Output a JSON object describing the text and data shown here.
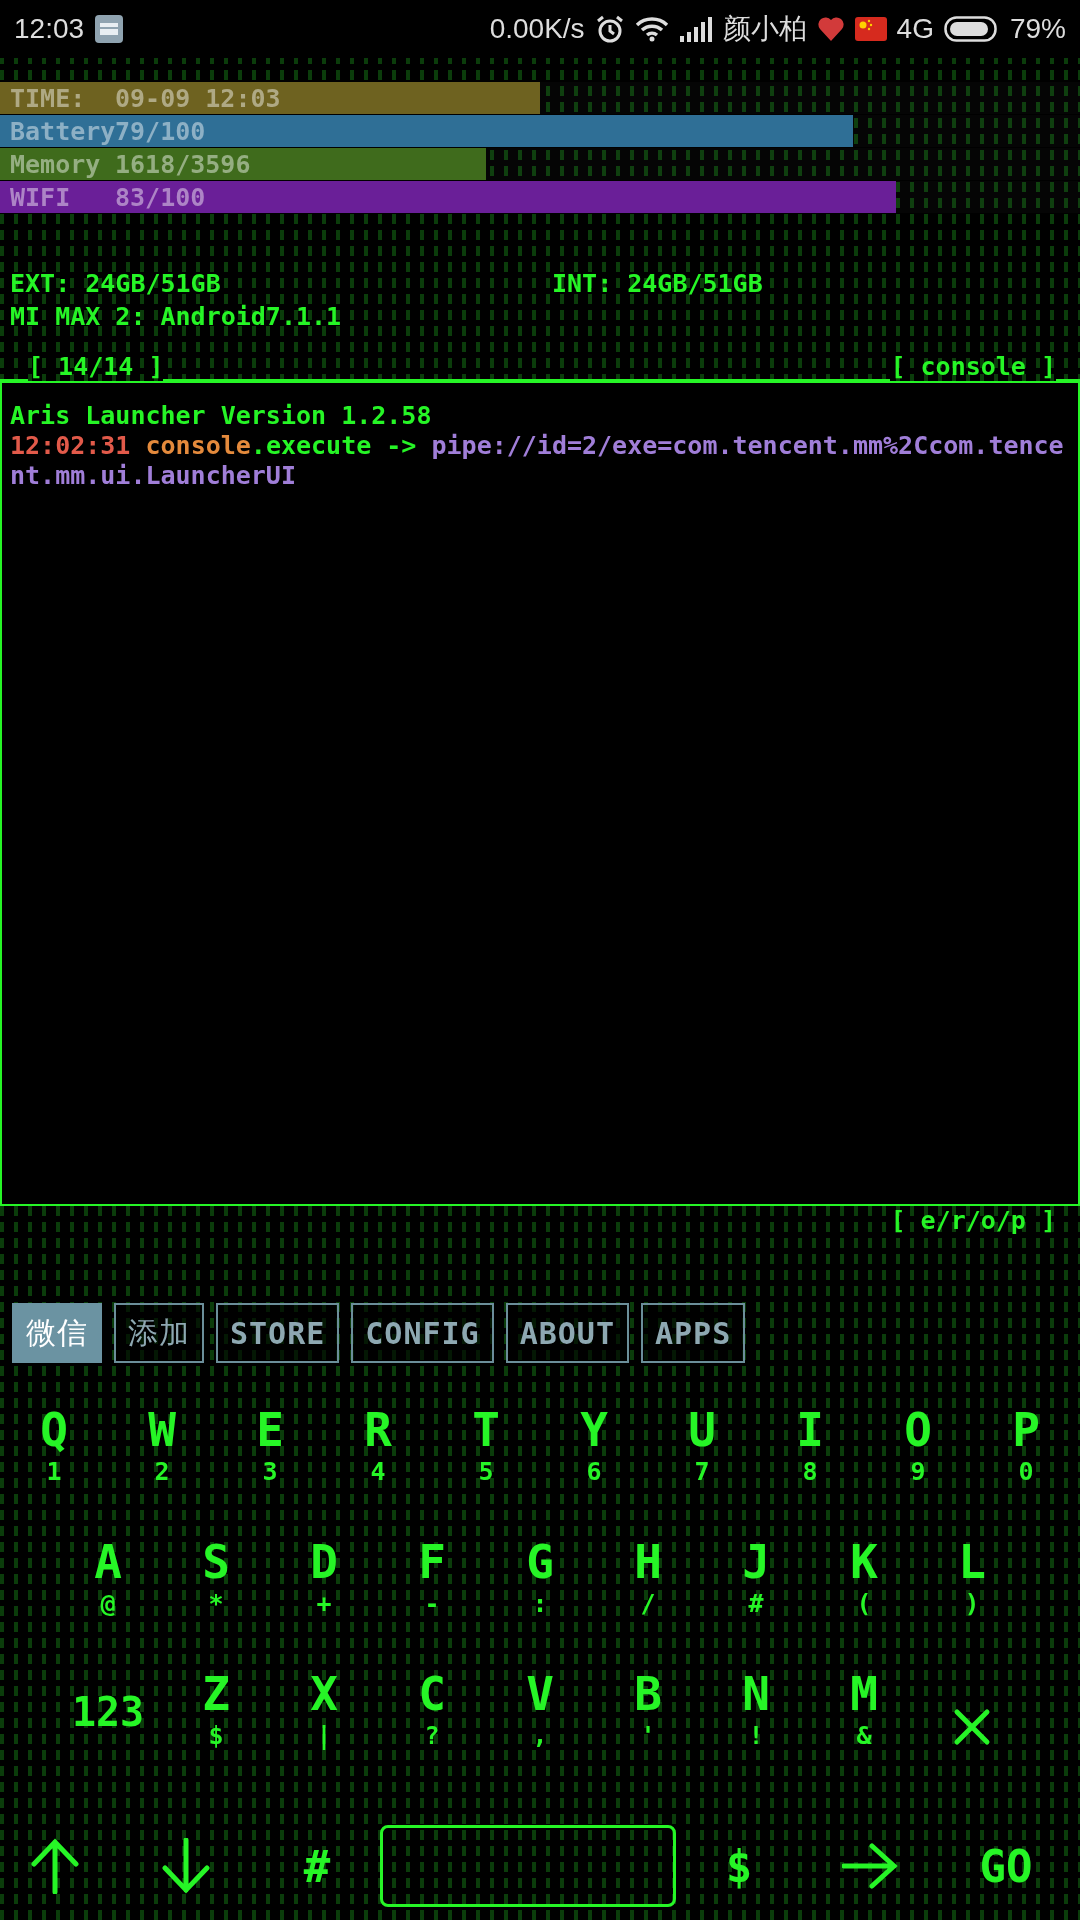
{
  "status_bar": {
    "time": "12:03",
    "net_speed": "0.00K/s",
    "carrier": "颜小柏",
    "network": "4G",
    "battery": "79%"
  },
  "stats": [
    {
      "label": "TIME:",
      "value": "09-09 12:03",
      "level": 0.5,
      "color": "#6e6220"
    },
    {
      "label": "Battery",
      "value": "79/100",
      "level": 0.79,
      "color": "#2f6f96"
    },
    {
      "label": "Memory",
      "value": "1618/3596",
      "level": 0.45,
      "color": "#3f6b1c"
    },
    {
      "label": "WIFI",
      "value": "83/100",
      "level": 0.83,
      "color": "#6a1f98"
    }
  ],
  "storage": {
    "ext": "EXT: 24GB/51GB",
    "int": "INT: 24GB/51GB",
    "device": "MI MAX 2: Android7.1.1"
  },
  "console": {
    "page": "[ 14/14 ]",
    "title": "[ console ]",
    "footer": "[ e/r/o/p ]",
    "lines": [
      [
        {
          "kind": "plain",
          "text": "Aris Launcher Version 1.2.58"
        }
      ],
      [
        {
          "kind": "time",
          "text": "12:02:31"
        },
        {
          "kind": "object",
          "text": "console"
        },
        {
          "kind": "plain",
          "text": ".execute ->"
        },
        {
          "kind": "arg",
          "text": "pipe://id=2/exe=com.tencent.mm%2Ccom.tencent.mm.ui.LauncherUI"
        }
      ]
    ]
  },
  "shortcuts": [
    {
      "label": "微信",
      "selected": true
    },
    {
      "label": "添加",
      "selected": false
    },
    {
      "label": "STORE",
      "selected": false
    },
    {
      "label": "CONFIG",
      "selected": false
    },
    {
      "label": "ABOUT",
      "selected": false
    },
    {
      "label": "APPS",
      "selected": false
    }
  ],
  "keyboard": {
    "rows": [
      [
        {
          "key": "Q",
          "sub": "1"
        },
        {
          "key": "W",
          "sub": "2"
        },
        {
          "key": "E",
          "sub": "3"
        },
        {
          "key": "R",
          "sub": "4"
        },
        {
          "key": "T",
          "sub": "5"
        },
        {
          "key": "Y",
          "sub": "6"
        },
        {
          "key": "U",
          "sub": "7"
        },
        {
          "key": "I",
          "sub": "8"
        },
        {
          "key": "O",
          "sub": "9"
        },
        {
          "key": "P",
          "sub": "0"
        }
      ],
      [
        {
          "key": "A",
          "sub": "@"
        },
        {
          "key": "S",
          "sub": "*"
        },
        {
          "key": "D",
          "sub": "+"
        },
        {
          "key": "F",
          "sub": "-"
        },
        {
          "key": "G",
          "sub": ":"
        },
        {
          "key": "H",
          "sub": "/"
        },
        {
          "key": "J",
          "sub": "#"
        },
        {
          "key": "K",
          "sub": "("
        },
        {
          "key": "L",
          "sub": ")"
        }
      ],
      [
        {
          "kind": "mode",
          "key": "123"
        },
        {
          "key": "Z",
          "sub": "$"
        },
        {
          "key": "X",
          "sub": "|"
        },
        {
          "key": "C",
          "sub": "?"
        },
        {
          "key": "V",
          "sub": ","
        },
        {
          "key": "B",
          "sub": "'"
        },
        {
          "key": "N",
          "sub": "!"
        },
        {
          "key": "M",
          "sub": "&"
        },
        {
          "kind": "delete"
        }
      ]
    ],
    "bottom": [
      {
        "kind": "up"
      },
      {
        "kind": "down"
      },
      {
        "kind": "char",
        "key": "#"
      },
      {
        "kind": "space"
      },
      {
        "kind": "char",
        "key": "$"
      },
      {
        "kind": "right"
      },
      {
        "kind": "char",
        "key": "GO"
      }
    ]
  }
}
